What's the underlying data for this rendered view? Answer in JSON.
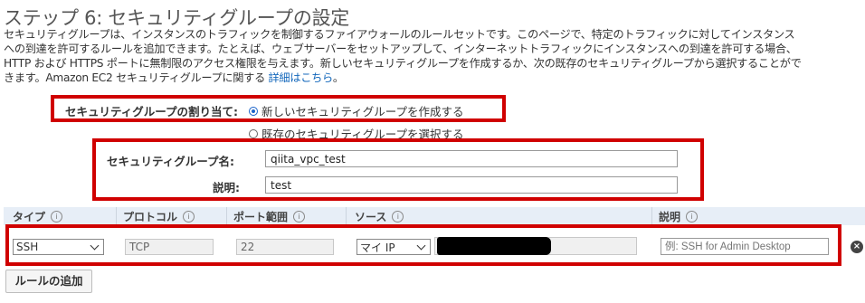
{
  "page": {
    "title": "ステップ 6: セキュリティグループの設定",
    "description_lines": [
      "セキュリティグループは、インスタンスのトラフィックを制御するファイアウォールのルールセットです。このページで、特定のトラフィックに対してインスタンス",
      "への到達を許可するルールを追加できます。たとえば、ウェブサーバーをセットアップして、インターネットトラフィックにインスタンスへの到達を許可する場合、",
      "HTTP および HTTPS ポートに無制限のアクセス権限を与えます。新しいセキュリティグループを作成するか、次の既存のセキュリティグループから選択することがで",
      "きます。Amazon EC2 セキュリティグループに関する "
    ],
    "details_link": "詳細はこちら",
    "details_suffix": "。"
  },
  "assign": {
    "label": "セキュリティグループの割り当て:",
    "options": [
      {
        "label": "新しいセキュリティグループを作成する",
        "selected": true
      },
      {
        "label": "既存のセキュリティグループを選択する",
        "selected": false
      }
    ]
  },
  "form": {
    "name_label": "セキュリティグループ名:",
    "name_value": "qiita_vpc_test",
    "desc_label": "説明:",
    "desc_value": "test"
  },
  "table": {
    "headers": [
      "タイプ",
      "プロトコル",
      "ポート範囲",
      "ソース",
      "説明"
    ],
    "info_glyph": "i",
    "rows": [
      {
        "type": "SSH",
        "protocol": "TCP",
        "port_range": "22",
        "source": "マイ IP",
        "source_value": "",
        "description_placeholder": "例: SSH for Admin Desktop",
        "delete_glyph": "×"
      }
    ]
  },
  "actions": {
    "add_rule": "ルールの追加"
  },
  "colors": {
    "highlight": "#d00000",
    "header_bg": "#e7eef7",
    "link": "#1166bb",
    "radio": "#1a63c9"
  }
}
